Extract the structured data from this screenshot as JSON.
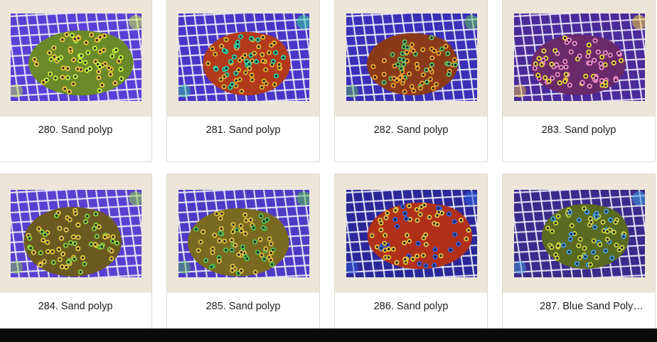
{
  "products": [
    {
      "title": "280. Sand polyp",
      "palette": {
        "bg": "#5a3fd6",
        "grid": "#f2f2ff",
        "coral": "#6a8a2a",
        "polyp": "#f0c640",
        "accent": "#c8f040"
      }
    },
    {
      "title": "281. Sand polyp",
      "palette": {
        "bg": "#4a35c8",
        "grid": "#f4f4ff",
        "coral": "#b23a1c",
        "polyp": "#e0b030",
        "accent": "#2fd0a0"
      }
    },
    {
      "title": "282. Sand polyp",
      "palette": {
        "bg": "#3b2fb8",
        "grid": "#f3f3ff",
        "coral": "#8a3a18",
        "polyp": "#f0a030",
        "accent": "#60c060"
      }
    },
    {
      "title": "283. Sand polyp",
      "palette": {
        "bg": "#4b2a9a",
        "grid": "#f0eeff",
        "coral": "#6a2a6a",
        "polyp": "#f08acb",
        "accent": "#f0d040"
      }
    },
    {
      "title": "284. Sand polyp",
      "palette": {
        "bg": "#5a40d0",
        "grid": "#f4f4ff",
        "coral": "#6a5a20",
        "polyp": "#e8c840",
        "accent": "#8ad040"
      }
    },
    {
      "title": "285. Sand polyp",
      "palette": {
        "bg": "#4f3ac6",
        "grid": "#f4f4ff",
        "coral": "#7a6a20",
        "polyp": "#e0c040",
        "accent": "#50c050"
      }
    },
    {
      "title": "286. Sand polyp",
      "palette": {
        "bg": "#2a2898",
        "grid": "#f2f2ff",
        "coral": "#b03018",
        "polyp": "#e0c040",
        "accent": "#3060e0"
      }
    },
    {
      "title": "287. Blue Sand Polyp...",
      "palette": {
        "bg": "#3a2a8a",
        "grid": "#f0f0ff",
        "coral": "#5a6a20",
        "polyp": "#c8d040",
        "accent": "#40a0e0"
      }
    }
  ],
  "colors": {
    "card_thumb_bg": "#ece6d9",
    "card_border": "#dedad4",
    "label_text": "#1d1d1d",
    "bottom_bar": "#0b0b0b"
  }
}
